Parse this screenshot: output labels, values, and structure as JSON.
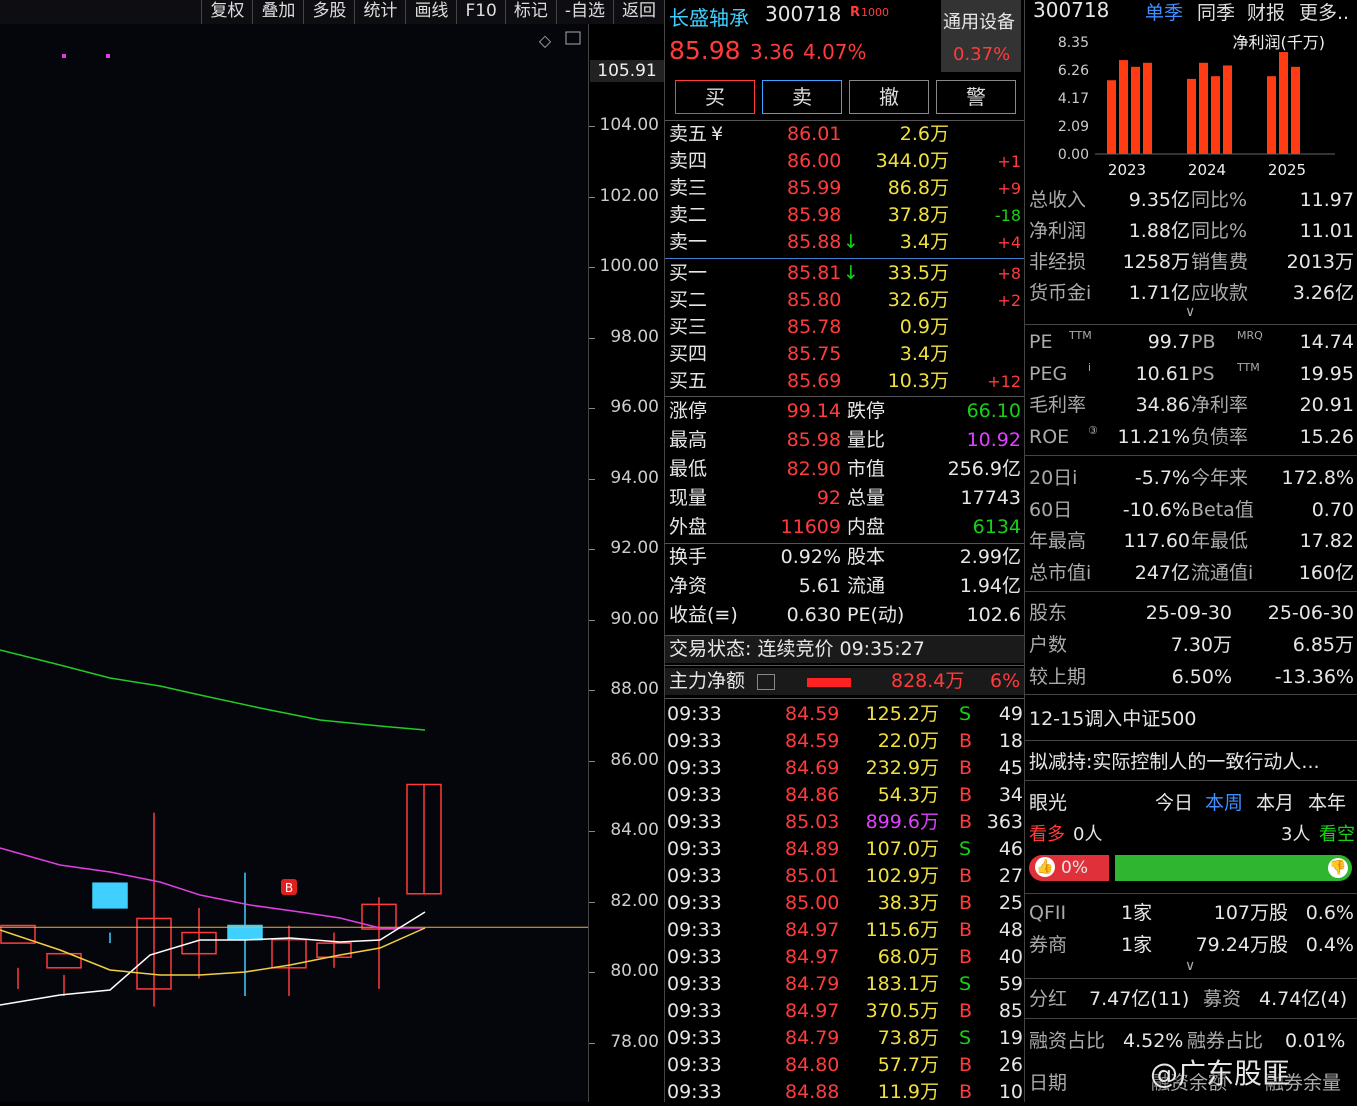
{
  "toolbar": {
    "items": [
      "复权",
      "叠加",
      "多股",
      "统计",
      "画线",
      "F10",
      "标记",
      "-自选",
      "返回"
    ]
  },
  "axis": {
    "top_value": "105.91",
    "ticks": [
      "104.00",
      "102.00",
      "100.00",
      "98.00",
      "96.00",
      "94.00",
      "92.00",
      "90.00",
      "88.00",
      "86.00",
      "84.00",
      "82.00",
      "80.00",
      "78.00"
    ]
  },
  "chart_marker": "B",
  "quote": {
    "name": "长盛轴承",
    "code": "300718",
    "tag": "R",
    "tag2": "1000",
    "price": "85.98",
    "change": "3.36",
    "change_pct": "4.07%",
    "sector": "通用设备",
    "sector_pct": "0.37%",
    "buttons": [
      "买",
      "卖",
      "撤",
      "警"
    ],
    "asks": [
      {
        "label": "卖五",
        "mark": "¥",
        "price": "86.01",
        "vol": "2.6万",
        "delta": ""
      },
      {
        "label": "卖四",
        "mark": "",
        "price": "86.00",
        "vol": "344.0万",
        "delta": "+1"
      },
      {
        "label": "卖三",
        "mark": "",
        "price": "85.99",
        "vol": "86.8万",
        "delta": "+9"
      },
      {
        "label": "卖二",
        "mark": "",
        "price": "85.98",
        "vol": "37.8万",
        "delta": "-18"
      },
      {
        "label": "卖一",
        "mark": "",
        "price": "85.88",
        "vol": "3.4万",
        "delta": "+4",
        "arrow": "↓"
      }
    ],
    "bids": [
      {
        "label": "买一",
        "price": "85.81",
        "vol": "33.5万",
        "delta": "+8",
        "arrow": "↓"
      },
      {
        "label": "买二",
        "price": "85.80",
        "vol": "32.6万",
        "delta": "+2"
      },
      {
        "label": "买三",
        "price": "85.78",
        "vol": "0.9万",
        "delta": ""
      },
      {
        "label": "买四",
        "price": "85.75",
        "vol": "3.4万",
        "delta": ""
      },
      {
        "label": "买五",
        "price": "85.69",
        "vol": "10.3万",
        "delta": "+12"
      }
    ],
    "stats1": [
      {
        "l1": "涨停",
        "v1": "99.14",
        "l2": "跌停",
        "v2": "66.10"
      },
      {
        "l1": "最高",
        "v1": "85.98",
        "l2": "量比",
        "v2": "10.92"
      },
      {
        "l1": "最低",
        "v1": "82.90",
        "l2": "市值",
        "v2": "256.9亿"
      },
      {
        "l1": "现量",
        "v1": "92",
        "l2": "总量",
        "v2": "17743"
      },
      {
        "l1": "外盘",
        "v1": "11609",
        "l2": "内盘",
        "v2": "6134"
      }
    ],
    "stats2": [
      {
        "l1": "换手",
        "v1": "0.92%",
        "l2": "股本",
        "v2": "2.99亿"
      },
      {
        "l1": "净资",
        "v1": "5.61",
        "l2": "流通",
        "v2": "1.94亿"
      },
      {
        "l1": "收益(≡)",
        "v1": "0.630",
        "l2": "PE(动)",
        "v2": "102.6"
      }
    ],
    "status": "交易状态: 连续竞价 09:35:27",
    "main_flow_label": "主力净额",
    "main_flow_value": "828.4万",
    "main_flow_pct": "6%",
    "ticks": [
      {
        "t": "09:33",
        "p": "84.59",
        "v": "125.2万",
        "s": "S",
        "n": "49"
      },
      {
        "t": "09:33",
        "p": "84.59",
        "v": "22.0万",
        "s": "B",
        "n": "18"
      },
      {
        "t": "09:33",
        "p": "84.69",
        "v": "232.9万",
        "s": "B",
        "n": "45"
      },
      {
        "t": "09:33",
        "p": "84.86",
        "v": "54.3万",
        "s": "B",
        "n": "34"
      },
      {
        "t": "09:33",
        "p": "85.03",
        "v": "899.6万",
        "s": "B",
        "n": "363"
      },
      {
        "t": "09:33",
        "p": "84.89",
        "v": "107.0万",
        "s": "S",
        "n": "46"
      },
      {
        "t": "09:33",
        "p": "85.01",
        "v": "102.9万",
        "s": "B",
        "n": "27"
      },
      {
        "t": "09:33",
        "p": "85.00",
        "v": "38.3万",
        "s": "B",
        "n": "25"
      },
      {
        "t": "09:33",
        "p": "84.97",
        "v": "115.6万",
        "s": "B",
        "n": "48"
      },
      {
        "t": "09:33",
        "p": "84.97",
        "v": "68.0万",
        "s": "B",
        "n": "40"
      },
      {
        "t": "09:33",
        "p": "84.79",
        "v": "183.1万",
        "s": "S",
        "n": "59"
      },
      {
        "t": "09:33",
        "p": "84.97",
        "v": "370.5万",
        "s": "B",
        "n": "85"
      },
      {
        "t": "09:33",
        "p": "84.79",
        "v": "73.8万",
        "s": "S",
        "n": "19"
      },
      {
        "t": "09:33",
        "p": "84.80",
        "v": "57.7万",
        "s": "B",
        "n": "26"
      },
      {
        "t": "09:33",
        "p": "84.88",
        "v": "11.9万",
        "s": "B",
        "n": "10"
      }
    ]
  },
  "fund": {
    "code": "300718",
    "tabs": [
      "单季",
      "同季",
      "财报",
      "更多.."
    ],
    "chart_title": "净利润(千万)",
    "chart_data": {
      "type": "bar",
      "title": "净利润(千万)",
      "ylim": [
        0,
        8.35
      ],
      "yticks": [
        "8.35",
        "6.26",
        "4.17",
        "2.09",
        "0.00"
      ],
      "groups": [
        {
          "year": "2023",
          "values": [
            5.5,
            7.0,
            6.5,
            6.8
          ]
        },
        {
          "year": "2024",
          "values": [
            5.6,
            6.8,
            5.8,
            6.6
          ]
        },
        {
          "year": "2025",
          "values": [
            5.8,
            7.6,
            6.5
          ]
        }
      ]
    },
    "fin": [
      {
        "l1": "总收入",
        "v1": "9.35亿",
        "l2": "同比%",
        "v2": "11.97"
      },
      {
        "l1": "净利润",
        "v1": "1.88亿",
        "l2": "同比%",
        "v2": "11.01"
      },
      {
        "l1": "非经损",
        "v1": "1258万",
        "l2": "销售费",
        "v2": "2013万"
      },
      {
        "l1": "货币金i",
        "v1": "1.71亿",
        "l2": "应收款",
        "v2": "3.26亿"
      }
    ],
    "valuation": [
      {
        "l1": "PE",
        "s1": "TTM",
        "v1": "99.7",
        "l2": "PB",
        "s2": "MRQ",
        "v2": "14.74"
      },
      {
        "l1": "PEG",
        "s1": "i",
        "v1": "10.61",
        "l2": "PS",
        "s2": "TTM",
        "v2": "19.95"
      },
      {
        "l1": "毛利率",
        "s1": "",
        "v1": "34.86",
        "l2": "净利率",
        "s2": "",
        "v2": "20.91"
      },
      {
        "l1": "ROE",
        "s1": "③",
        "v1": "11.21%",
        "l2": "负债率",
        "s2": "",
        "v2": "15.26"
      }
    ],
    "perf": [
      {
        "l1": "20日i",
        "v1": "-5.7%",
        "l2": "今年来",
        "v2": "172.8%"
      },
      {
        "l1": "60日",
        "v1": "-10.6%",
        "l2": "Beta值",
        "v2": "0.70"
      },
      {
        "l1": "年最高",
        "v1": "117.60",
        "l2": "年最低",
        "v2": "17.82"
      },
      {
        "l1": "总市值i",
        "v1": "247亿",
        "l2": "流通值i",
        "v2": "160亿"
      }
    ],
    "holders": [
      {
        "l": "股东",
        "a": "25-09-30",
        "b": "25-06-30"
      },
      {
        "l": "户数",
        "a": "7.30万",
        "b": "6.85万"
      },
      {
        "l": "较上期",
        "a": "6.50%",
        "b": "-13.36%"
      }
    ],
    "news1": "12-15调入中证500",
    "news2": "拟减持:实际控制人的一致行动人...",
    "eye_label": "眼光",
    "eye_tabs": [
      "今日",
      "本周",
      "本月",
      "本年"
    ],
    "bull_label": "看多",
    "bull_count": "0人",
    "bear_count": "3人",
    "bear_label": "看空",
    "bull_pct": "0%",
    "inst": [
      {
        "l": "QFII",
        "n": "1家",
        "v": "107万股",
        "p": "0.6%"
      },
      {
        "l": "券商",
        "n": "1家",
        "v": "79.24万股",
        "p": "0.4%"
      }
    ],
    "div_label": "分红",
    "div_value": "7.47亿(11)",
    "raise_label": "募资",
    "raise_value": "4.74亿(4)",
    "margin_label": "融资占比",
    "margin_value": "4.52%",
    "short_label": "融券占比",
    "short_value": "0.01%",
    "date_label": "日期",
    "footer_cols": [
      "融资余额",
      "融券余量"
    ]
  },
  "watermark": "@广东股匪"
}
